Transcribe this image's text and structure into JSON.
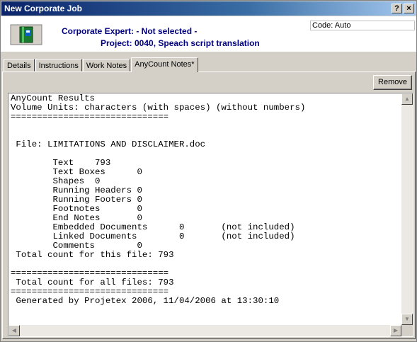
{
  "window": {
    "title": "New Corporate Job"
  },
  "titlebar_buttons": {
    "help": "?",
    "close": "×"
  },
  "header": {
    "expert": "Corporate Expert: - Not selected -",
    "project": "Project: 0040, Speach script translation",
    "code": "Code: Auto"
  },
  "tabs": [
    {
      "label": "Details"
    },
    {
      "label": "Instructions"
    },
    {
      "label": "Work Notes"
    },
    {
      "label": "AnyCount Notes*"
    }
  ],
  "toolbar": {
    "remove_label": "Remove"
  },
  "results": {
    "text": "AnyCount Results\nVolume Units: characters (with spaces) (without numbers)\n==============================\n\n\n File: LIMITATIONS AND DISCLAIMER.doc\n\n        Text    793\n        Text Boxes      0\n        Shapes  0\n        Running Headers 0\n        Running Footers 0\n        Footnotes       0\n        End Notes       0\n        Embedded Documents      0       (not included)\n        Linked Documents        0       (not included)\n        Comments        0\n Total count for this file: 793\n\n==============================\n Total count for all files: 793\n==============================\n Generated by Projetex 2006, 11/04/2006 at 13:30:10"
  },
  "colors": {
    "header_text": "#000080",
    "titlebar": "#0a246a",
    "chrome": "#d4d0c8"
  },
  "icons": {
    "app": "book-icon"
  }
}
